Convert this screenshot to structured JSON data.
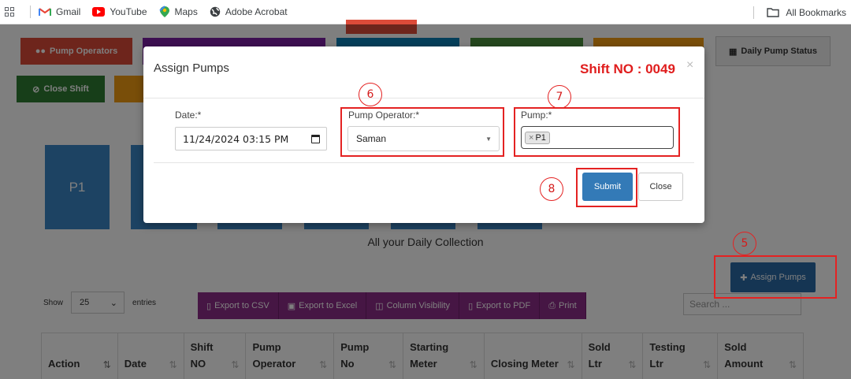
{
  "bookmarks": {
    "items": [
      {
        "label": "Gmail",
        "icon": "gmail-icon"
      },
      {
        "label": "YouTube",
        "icon": "youtube-icon"
      },
      {
        "label": "Maps",
        "icon": "maps-icon"
      },
      {
        "label": "Adobe Acrobat",
        "icon": "globe-icon"
      }
    ],
    "all_bookmarks": "All Bookmarks"
  },
  "page": {
    "pump_operators_btn": "Pump Operators",
    "close_shift_btn": "Close Shift",
    "daily_pump_status_btn": "Daily Pump Status",
    "tile_p1": "P1",
    "daily_collection": "All your Daily Collection",
    "assign_pumps_btn": "Assign Pumps",
    "show_label": "Show",
    "entries_value": "25",
    "entries_label": "entries",
    "export": [
      "Export to CSV",
      "Export to Excel",
      "Column Visibility",
      "Export to PDF",
      "Print"
    ],
    "search_placeholder": "Search ...",
    "table_headers": [
      "Action",
      "Date",
      "Shift NO",
      "Pump Operator",
      "Pump No",
      "Starting Meter",
      "Closing Meter",
      "Sold Ltr",
      "Testing Ltr",
      "Sold Amount"
    ]
  },
  "modal": {
    "title": "Assign Pumps",
    "shift_no": "Shift NO : 0049",
    "close_x": "×",
    "date_label": "Date:*",
    "date_value": "11/24/2024 03:15 PM",
    "operator_label": "Pump Operator:*",
    "operator_value": "Saman",
    "pump_label": "Pump:*",
    "pump_chip": "P1",
    "chip_remove": "×",
    "submit": "Submit",
    "close": "Close"
  },
  "annotations": {
    "step5": "5",
    "step6": "6",
    "step7": "7",
    "step8": "8"
  },
  "colors": {
    "pump_operators": "#dd4b39",
    "close_shift": "#2e7d32",
    "shift_no": "#e01d1d",
    "submit": "#337ab7",
    "export": "#8d2d88",
    "annotation": "#e42222"
  }
}
